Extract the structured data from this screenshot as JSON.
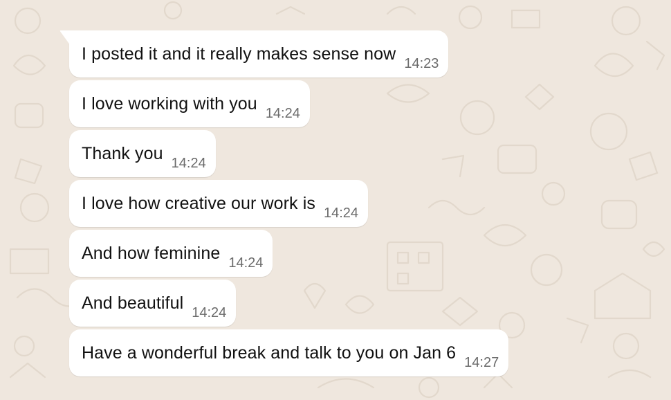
{
  "theme": {
    "wallpaper_color": "#efe7de",
    "bubble_color": "#ffffff",
    "text_color": "#111111",
    "time_color": "#6b6b6b"
  },
  "messages": [
    {
      "text": "I posted it and it really makes sense now",
      "time": "14:23"
    },
    {
      "text": "I love working with you",
      "time": "14:24"
    },
    {
      "text": "Thank you",
      "time": "14:24"
    },
    {
      "text": "I love how creative our work is",
      "time": "14:24"
    },
    {
      "text": "And how feminine",
      "time": "14:24"
    },
    {
      "text": "And beautiful",
      "time": "14:24"
    },
    {
      "text": "Have a wonderful break and talk to you on Jan 6",
      "time": "14:27"
    }
  ]
}
